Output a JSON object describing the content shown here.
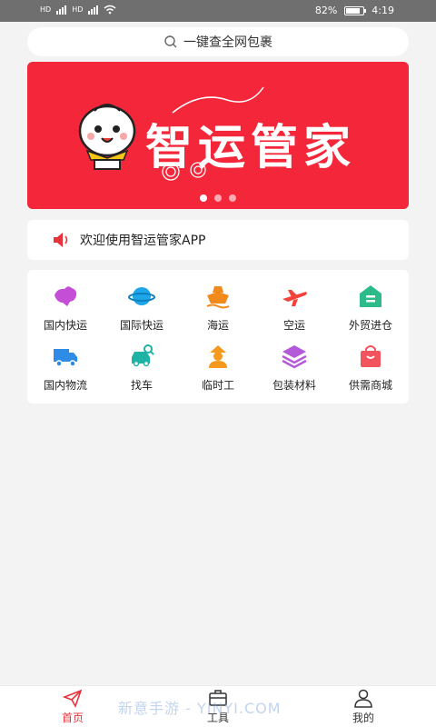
{
  "status_bar": {
    "battery_pct": "82%",
    "time": "4:19",
    "battery_level": 0.82
  },
  "search": {
    "placeholder": "一键查全网包裹"
  },
  "banner": {
    "title": "智运管家",
    "slide_count": 3,
    "active_slide": 0,
    "color": "#f4263a"
  },
  "notice": {
    "text": "欢迎使用智运管家APP"
  },
  "services": [
    {
      "label": "国内快运",
      "icon": "china-map-icon",
      "color": "#c44fd6"
    },
    {
      "label": "国际快运",
      "icon": "planet-icon",
      "color": "#1ea7e8"
    },
    {
      "label": "海运",
      "icon": "ship-icon",
      "color": "#f28a1e"
    },
    {
      "label": "空运",
      "icon": "airplane-icon",
      "color": "#f2423a"
    },
    {
      "label": "外贸进仓",
      "icon": "warehouse-icon",
      "color": "#2dbb8a"
    },
    {
      "label": "国内物流",
      "icon": "truck-icon",
      "color": "#2e8be6"
    },
    {
      "label": "找车",
      "icon": "car-search-icon",
      "color": "#1fb3a6"
    },
    {
      "label": "临时工",
      "icon": "worker-icon",
      "color": "#f59a1f"
    },
    {
      "label": "包装材料",
      "icon": "layers-icon",
      "color": "#b35ad8"
    },
    {
      "label": "供需商城",
      "icon": "shopping-bag-icon",
      "color": "#f2545e"
    }
  ],
  "tabs": [
    {
      "label": "首页",
      "icon": "paper-plane-icon",
      "active": true
    },
    {
      "label": "工具",
      "icon": "toolbox-icon",
      "active": false
    },
    {
      "label": "我的",
      "icon": "user-icon",
      "active": false
    }
  ],
  "watermark": "新意手游 - YINYI.COM",
  "accent_color": "#e8323a"
}
